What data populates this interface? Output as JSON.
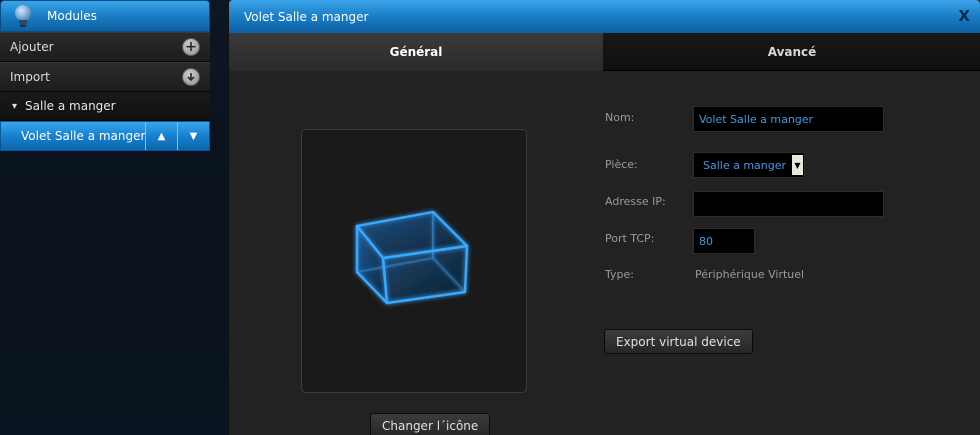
{
  "sidebar": {
    "header_title": "Modules",
    "header_icon": "lightbulb-icon",
    "rows": [
      {
        "label": "Ajouter",
        "icon": "plus-circle-icon"
      },
      {
        "label": "Import",
        "icon": "download-circle-icon"
      }
    ],
    "group_label": "Salle a manger",
    "selected_item": "Volet Salle a manger"
  },
  "window": {
    "title": "Volet Salle a manger",
    "close_label": "X",
    "tabs": [
      {
        "label": "Général",
        "active": true
      },
      {
        "label": "Avancé",
        "active": false
      }
    ],
    "change_icon_label": "Changer l´icône",
    "form": {
      "name_label": "Nom:",
      "name_value": "Volet Salle a manger",
      "room_label": "Pièce:",
      "room_value": "Salle a manger",
      "ip_label": "Adresse IP:",
      "ip_value": "",
      "port_label": "Port TCP:",
      "port_value": "80",
      "type_label": "Type:",
      "type_value": "Périphérique Virtuel",
      "export_label": "Export virtual device"
    }
  },
  "colors": {
    "accent": "#1a7fc6",
    "field_text": "#3f9be0",
    "cube": "#2fa6ff"
  }
}
